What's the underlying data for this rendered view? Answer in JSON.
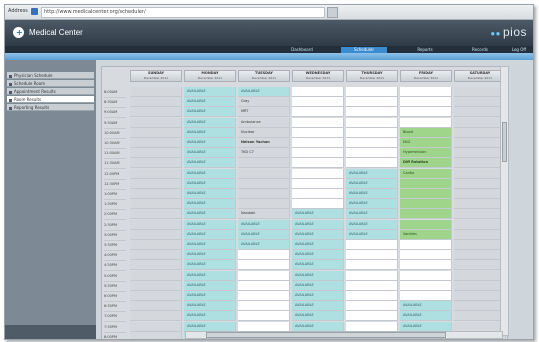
{
  "address_bar": {
    "label": "Address",
    "url": "http://www.medicalcenter.org/scheduler/"
  },
  "header": {
    "title": "Medical Center",
    "brand": "pios"
  },
  "tabs": [
    "Dashboard",
    "Scheduler",
    "Reports",
    "Records",
    "Log Off"
  ],
  "active_tab": 1,
  "sidebar": [
    {
      "label": "Physician Schedule"
    },
    {
      "label": "Schedule Room"
    },
    {
      "label": "Appointment Results"
    },
    {
      "label": "Room Results"
    },
    {
      "label": "Reporting Results"
    }
  ],
  "active_sidebar": 3,
  "days": [
    {
      "name": "SUNDAY",
      "date": "December 2011"
    },
    {
      "name": "MONDAY",
      "date": "December 2011"
    },
    {
      "name": "TUESDAY",
      "date": "December 2011"
    },
    {
      "name": "WEDNESDAY",
      "date": "December 2011"
    },
    {
      "name": "THURSDAY",
      "date": "December 2011"
    },
    {
      "name": "FRIDAY",
      "date": "December 2011"
    },
    {
      "name": "SATURDAY",
      "date": "December 2011"
    }
  ],
  "times": [
    "8:00AM",
    "8:30AM",
    "9:00AM",
    "9:30AM",
    "10:00AM",
    "10:30AM",
    "11:00AM",
    "11:30AM",
    "12:00PM",
    "12:30PM",
    "1:00PM",
    "1:30PM",
    "2:00PM",
    "2:30PM",
    "3:00PM",
    "3:30PM",
    "4:00PM",
    "4:30PM",
    "5:00PM",
    "5:30PM",
    "6:00PM",
    "6:30PM",
    "7:00PM",
    "7:30PM",
    "8:00PM"
  ],
  "columns": [
    {
      "cells": [
        {
          "t": "g",
          "x": ""
        },
        {
          "t": "g",
          "x": ""
        },
        {
          "t": "g",
          "x": ""
        },
        {
          "t": "g",
          "x": ""
        },
        {
          "t": "g",
          "x": ""
        },
        {
          "t": "g",
          "x": ""
        },
        {
          "t": "g",
          "x": ""
        },
        {
          "t": "g",
          "x": ""
        },
        {
          "t": "g",
          "x": ""
        },
        {
          "t": "g",
          "x": ""
        },
        {
          "t": "g",
          "x": ""
        },
        {
          "t": "g",
          "x": ""
        },
        {
          "t": "g",
          "x": ""
        },
        {
          "t": "g",
          "x": ""
        },
        {
          "t": "g",
          "x": ""
        },
        {
          "t": "g",
          "x": ""
        },
        {
          "t": "g",
          "x": ""
        },
        {
          "t": "g",
          "x": ""
        },
        {
          "t": "g",
          "x": ""
        },
        {
          "t": "g",
          "x": ""
        },
        {
          "t": "g",
          "x": ""
        },
        {
          "t": "g",
          "x": ""
        },
        {
          "t": "g",
          "x": ""
        },
        {
          "t": "g",
          "x": ""
        },
        {
          "t": "g",
          "x": ""
        }
      ]
    },
    {
      "cells": [
        {
          "t": "c",
          "x": "AVAILABLE"
        },
        {
          "t": "c",
          "x": "AVAILABLE"
        },
        {
          "t": "c",
          "x": "AVAILABLE"
        },
        {
          "t": "c",
          "x": "AVAILABLE"
        },
        {
          "t": "c",
          "x": "AVAILABLE"
        },
        {
          "t": "c",
          "x": "AVAILABLE"
        },
        {
          "t": "c",
          "x": "AVAILABLE"
        },
        {
          "t": "c",
          "x": "AVAILABLE"
        },
        {
          "t": "c",
          "x": "AVAILABLE"
        },
        {
          "t": "c",
          "x": "AVAILABLE"
        },
        {
          "t": "c",
          "x": "AVAILABLE"
        },
        {
          "t": "c",
          "x": "AVAILABLE"
        },
        {
          "t": "c",
          "x": "AVAILABLE"
        },
        {
          "t": "c",
          "x": "AVAILABLE"
        },
        {
          "t": "c",
          "x": "AVAILABLE"
        },
        {
          "t": "c",
          "x": "AVAILABLE"
        },
        {
          "t": "c",
          "x": "AVAILABLE"
        },
        {
          "t": "c",
          "x": "AVAILABLE"
        },
        {
          "t": "c",
          "x": "AVAILABLE"
        },
        {
          "t": "c",
          "x": "AVAILABLE"
        },
        {
          "t": "c",
          "x": "AVAILABLE"
        },
        {
          "t": "c",
          "x": "AVAILABLE"
        },
        {
          "t": "c",
          "x": "AVAILABLE"
        },
        {
          "t": "c",
          "x": "AVAILABLE"
        },
        {
          "t": "c",
          "x": "AVAILABLE"
        }
      ]
    },
    {
      "cells": [
        {
          "t": "c",
          "x": "AVAILABLE"
        },
        {
          "t": "g",
          "x": "Gray"
        },
        {
          "t": "g",
          "x": "MRT"
        },
        {
          "t": "g",
          "x": "Ambulance"
        },
        {
          "t": "g",
          "x": "Nuclear"
        },
        {
          "t": "g",
          "x": "Nelson Yachan",
          "b": true
        },
        {
          "t": "g",
          "x": "TKD C7"
        },
        {
          "t": "g",
          "x": ""
        },
        {
          "t": "g",
          "x": ""
        },
        {
          "t": "g",
          "x": ""
        },
        {
          "t": "g",
          "x": ""
        },
        {
          "t": "g",
          "x": ""
        },
        {
          "t": "g",
          "x": "Nandaki"
        },
        {
          "t": "c",
          "x": "AVAILABLE"
        },
        {
          "t": "c",
          "x": "AVAILABLE"
        },
        {
          "t": "c",
          "x": "AVAILABLE"
        },
        {
          "t": "e",
          "x": ""
        },
        {
          "t": "e",
          "x": ""
        },
        {
          "t": "e",
          "x": ""
        },
        {
          "t": "e",
          "x": ""
        },
        {
          "t": "e",
          "x": ""
        },
        {
          "t": "e",
          "x": ""
        },
        {
          "t": "e",
          "x": ""
        },
        {
          "t": "e",
          "x": ""
        },
        {
          "t": "e",
          "x": ""
        }
      ]
    },
    {
      "cells": [
        {
          "t": "e",
          "x": ""
        },
        {
          "t": "e",
          "x": ""
        },
        {
          "t": "e",
          "x": ""
        },
        {
          "t": "e",
          "x": ""
        },
        {
          "t": "e",
          "x": ""
        },
        {
          "t": "e",
          "x": ""
        },
        {
          "t": "e",
          "x": ""
        },
        {
          "t": "e",
          "x": ""
        },
        {
          "t": "e",
          "x": ""
        },
        {
          "t": "e",
          "x": ""
        },
        {
          "t": "e",
          "x": ""
        },
        {
          "t": "e",
          "x": ""
        },
        {
          "t": "c",
          "x": "AVAILABLE"
        },
        {
          "t": "c",
          "x": "AVAILABLE"
        },
        {
          "t": "c",
          "x": "AVAILABLE"
        },
        {
          "t": "c",
          "x": "AVAILABLE"
        },
        {
          "t": "c",
          "x": "AVAILABLE"
        },
        {
          "t": "c",
          "x": "AVAILABLE"
        },
        {
          "t": "c",
          "x": "AVAILABLE"
        },
        {
          "t": "c",
          "x": "AVAILABLE"
        },
        {
          "t": "c",
          "x": "AVAILABLE"
        },
        {
          "t": "c",
          "x": "AVAILABLE"
        },
        {
          "t": "c",
          "x": "AVAILABLE"
        },
        {
          "t": "c",
          "x": "AVAILABLE"
        },
        {
          "t": "c",
          "x": "AVAILABLE"
        }
      ]
    },
    {
      "cells": [
        {
          "t": "e",
          "x": ""
        },
        {
          "t": "e",
          "x": ""
        },
        {
          "t": "e",
          "x": ""
        },
        {
          "t": "e",
          "x": ""
        },
        {
          "t": "e",
          "x": ""
        },
        {
          "t": "e",
          "x": ""
        },
        {
          "t": "e",
          "x": ""
        },
        {
          "t": "e",
          "x": ""
        },
        {
          "t": "c",
          "x": "AVAILABLE"
        },
        {
          "t": "c",
          "x": "AVAILABLE"
        },
        {
          "t": "c",
          "x": "AVAILABLE"
        },
        {
          "t": "c",
          "x": "AVAILABLE"
        },
        {
          "t": "c",
          "x": "AVAILABLE"
        },
        {
          "t": "c",
          "x": "AVAILABLE"
        },
        {
          "t": "c",
          "x": "AVAILABLE"
        },
        {
          "t": "e",
          "x": ""
        },
        {
          "t": "e",
          "x": ""
        },
        {
          "t": "e",
          "x": ""
        },
        {
          "t": "e",
          "x": ""
        },
        {
          "t": "e",
          "x": ""
        },
        {
          "t": "e",
          "x": ""
        },
        {
          "t": "e",
          "x": ""
        },
        {
          "t": "e",
          "x": ""
        },
        {
          "t": "e",
          "x": ""
        },
        {
          "t": "e",
          "x": ""
        }
      ]
    },
    {
      "cells": [
        {
          "t": "e",
          "x": ""
        },
        {
          "t": "e",
          "x": ""
        },
        {
          "t": "e",
          "x": ""
        },
        {
          "t": "e",
          "x": ""
        },
        {
          "t": "n",
          "x": "Blood"
        },
        {
          "t": "n",
          "x": "EKG"
        },
        {
          "t": "n",
          "x": "Hypertension"
        },
        {
          "t": "n",
          "x": "Diff Rotation",
          "b": true
        },
        {
          "t": "n",
          "x": "Cardio"
        },
        {
          "t": "n",
          "x": ""
        },
        {
          "t": "n",
          "x": ""
        },
        {
          "t": "n",
          "x": ""
        },
        {
          "t": "n",
          "x": ""
        },
        {
          "t": "n",
          "x": ""
        },
        {
          "t": "n",
          "x": "Vanities"
        },
        {
          "t": "e",
          "x": ""
        },
        {
          "t": "e",
          "x": ""
        },
        {
          "t": "e",
          "x": ""
        },
        {
          "t": "e",
          "x": ""
        },
        {
          "t": "e",
          "x": ""
        },
        {
          "t": "e",
          "x": ""
        },
        {
          "t": "c",
          "x": "AVAILABLE"
        },
        {
          "t": "c",
          "x": "AVAILABLE"
        },
        {
          "t": "c",
          "x": "AVAILABLE"
        },
        {
          "t": "e",
          "x": ""
        }
      ]
    },
    {
      "cells": [
        {
          "t": "g",
          "x": ""
        },
        {
          "t": "g",
          "x": ""
        },
        {
          "t": "g",
          "x": ""
        },
        {
          "t": "g",
          "x": ""
        },
        {
          "t": "g",
          "x": ""
        },
        {
          "t": "g",
          "x": ""
        },
        {
          "t": "g",
          "x": ""
        },
        {
          "t": "g",
          "x": ""
        },
        {
          "t": "g",
          "x": ""
        },
        {
          "t": "g",
          "x": ""
        },
        {
          "t": "g",
          "x": ""
        },
        {
          "t": "g",
          "x": ""
        },
        {
          "t": "g",
          "x": ""
        },
        {
          "t": "g",
          "x": ""
        },
        {
          "t": "g",
          "x": ""
        },
        {
          "t": "g",
          "x": ""
        },
        {
          "t": "g",
          "x": ""
        },
        {
          "t": "g",
          "x": ""
        },
        {
          "t": "g",
          "x": ""
        },
        {
          "t": "g",
          "x": ""
        },
        {
          "t": "g",
          "x": ""
        },
        {
          "t": "g",
          "x": ""
        },
        {
          "t": "g",
          "x": ""
        },
        {
          "t": "g",
          "x": ""
        },
        {
          "t": "g",
          "x": ""
        }
      ]
    }
  ]
}
